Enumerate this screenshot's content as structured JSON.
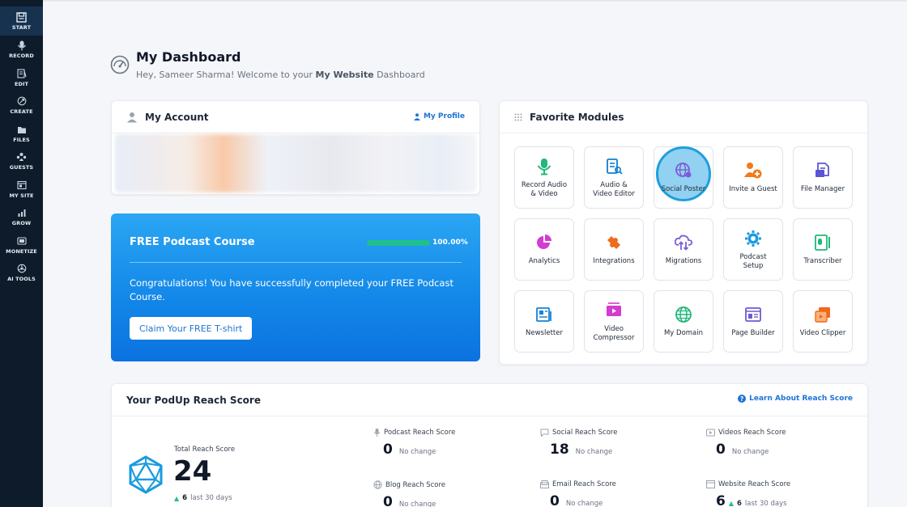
{
  "sidebar": {
    "items": [
      {
        "label": "START",
        "icon": "start-icon",
        "active": true
      },
      {
        "label": "RECORD",
        "icon": "microphone-icon"
      },
      {
        "label": "EDIT",
        "icon": "edit-icon"
      },
      {
        "label": "CREATE",
        "icon": "create-icon"
      },
      {
        "label": "FILES",
        "icon": "files-icon"
      },
      {
        "label": "GUESTS",
        "icon": "guests-icon"
      },
      {
        "label": "MY SITE",
        "icon": "my-site-icon"
      },
      {
        "label": "GROW",
        "icon": "grow-icon"
      },
      {
        "label": "MONETIZE",
        "icon": "monetize-icon"
      },
      {
        "label": "AI TOOLS",
        "icon": "ai-tools-icon"
      }
    ]
  },
  "header": {
    "title": "My Dashboard",
    "subtitle_prefix": "Hey, Sameer Sharma! Welcome to your ",
    "subtitle_bold": "My Website",
    "subtitle_suffix": " Dashboard"
  },
  "account": {
    "title": "My Account",
    "profile_link": "My Profile"
  },
  "course": {
    "title": "FREE Podcast Course",
    "progress_label": "100.00%",
    "progress": 1.0,
    "message": "Congratulations! You have successfully completed your FREE Podcast Course.",
    "button": "Claim Your FREE T-shirt"
  },
  "favorites": {
    "title": "Favorite Modules",
    "modules": [
      {
        "label": "Record Audio & Video",
        "icon": "microphone-icon"
      },
      {
        "label": "Audio & Video Editor",
        "icon": "editor-icon"
      },
      {
        "label": "Social Poster",
        "icon": "social-poster-icon"
      },
      {
        "label": "Invite a Guest",
        "icon": "invite-guest-icon"
      },
      {
        "label": "File Manager",
        "icon": "file-manager-icon"
      },
      {
        "label": "Analytics",
        "icon": "analytics-icon"
      },
      {
        "label": "Integrations",
        "icon": "puzzle-icon"
      },
      {
        "label": "Migrations",
        "icon": "cloud-migration-icon"
      },
      {
        "label": "Podcast Setup",
        "icon": "gear-icon"
      },
      {
        "label": "Transcriber",
        "icon": "transcriber-icon"
      },
      {
        "label": "Newsletter",
        "icon": "newsletter-icon"
      },
      {
        "label": "Video Compressor",
        "icon": "video-compressor-icon"
      },
      {
        "label": "My Domain",
        "icon": "globe-icon"
      },
      {
        "label": "Page Builder",
        "icon": "page-builder-icon"
      },
      {
        "label": "Video Clipper",
        "icon": "video-clipper-icon"
      }
    ]
  },
  "reach": {
    "title": "Your PodUp Reach Score",
    "learn_link": "Learn About Reach Score",
    "total_label": "Total Reach Score",
    "total_value": "24",
    "total_change": "6",
    "total_period": "last 30 days",
    "metrics": [
      {
        "label": "Podcast Reach Score",
        "value": "0",
        "change": "No change",
        "icon": "microphone-icon"
      },
      {
        "label": "Social Reach Score",
        "value": "18",
        "change": "No change",
        "icon": "chat-icon"
      },
      {
        "label": "Videos Reach Score",
        "value": "0",
        "change": "No change",
        "icon": "video-icon"
      },
      {
        "label": "Blog Reach Score",
        "value": "0",
        "change": "No change",
        "icon": "globe-icon"
      },
      {
        "label": "Email Reach Score",
        "value": "0",
        "change": "No change",
        "icon": "email-icon"
      },
      {
        "label": "Website Reach Score",
        "value": "6",
        "change_value": "6",
        "change": "last 30 days",
        "icon": "website-icon"
      }
    ]
  },
  "colors": {
    "sidebar_bg": "#0d1b2a",
    "accent": "#1d74d6",
    "success": "#1fc08b"
  }
}
